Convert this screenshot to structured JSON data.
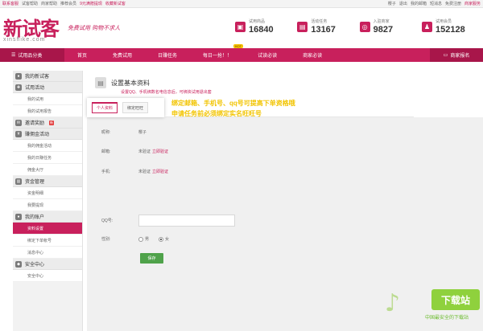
{
  "topbar": {
    "left": [
      "联系客服",
      "试客帮助",
      "商家帮助",
      "推荐会员",
      "9元满赠提现",
      "收藏新试客"
    ],
    "greeting": "樱子",
    "right": [
      "退出",
      "我的邮箱",
      "短消息",
      "免费注册",
      "商家服务"
    ]
  },
  "logo": {
    "cn": "新试客",
    "en": "xinshike.com",
    "slogan": "免费试用  购物不求人"
  },
  "stats": [
    {
      "icon": "product-icon",
      "label": "试用商品",
      "value": "16840"
    },
    {
      "icon": "task-icon",
      "label": "活动任务",
      "value": "13167"
    },
    {
      "icon": "merchant-icon",
      "label": "入驻商家",
      "value": "9827"
    },
    {
      "icon": "member-icon",
      "label": "试用会员",
      "value": "152128"
    }
  ],
  "nav": {
    "category": "试用品分类",
    "items": [
      "首页",
      "免费试用",
      "日赚任务",
      "每日一抢！！",
      "试读必读",
      "商家必读"
    ],
    "hot_badge": "HOT",
    "merchant": "商家报名"
  },
  "sidebar": {
    "sections": [
      {
        "title": "我的新试客",
        "icon": "user-icon",
        "items": []
      },
      {
        "title": "试用活动",
        "icon": "gift-icon",
        "items": [
          "我的试用",
          "我的试用报告"
        ]
      },
      {
        "title": "邀请奖励",
        "icon": "invite-icon",
        "badge": "新",
        "items": []
      },
      {
        "title": "赚佣金活动",
        "icon": "coin-icon",
        "items": [
          "我的佣金活动",
          "我的日赚任务",
          "佣金大厅"
        ]
      },
      {
        "title": "资金管理",
        "icon": "wallet-icon",
        "items": [
          "资金明细",
          "我要提现"
        ]
      },
      {
        "title": "我的账户",
        "icon": "account-icon",
        "items": [
          "资料设置",
          "绑定下单帐号",
          "消息中心"
        ]
      },
      {
        "title": "安全中心",
        "icon": "shield-icon",
        "items": [
          "安全中心"
        ]
      }
    ],
    "active_item": "资料设置"
  },
  "main": {
    "title": "设置基本资料",
    "subtitle": "设置QQ、手机绑数名电信息后，可绑资试用退出套",
    "tabs": [
      "个人资料",
      "绑定旺旺"
    ],
    "annotation_line1": "绑定邮箱、手机号、qq号可提高下单资格哦",
    "annotation_line2": "申请任务前必须绑定实名旺旺号",
    "fields": {
      "nickname_label": "昵称:",
      "nickname_value": "樱子",
      "email_label": "邮箱:",
      "email_status": "未验证",
      "email_link": "立即验证",
      "phone_label": "手机:",
      "phone_status": "未验证",
      "phone_link": "立即验证",
      "qq_label": "QQ号:",
      "gender_label": "性别:",
      "gender_male": "男",
      "gender_female": "女",
      "save": "保存"
    }
  },
  "watermark": {
    "badge": "下载站",
    "caption": "中国最安全的下载站"
  }
}
